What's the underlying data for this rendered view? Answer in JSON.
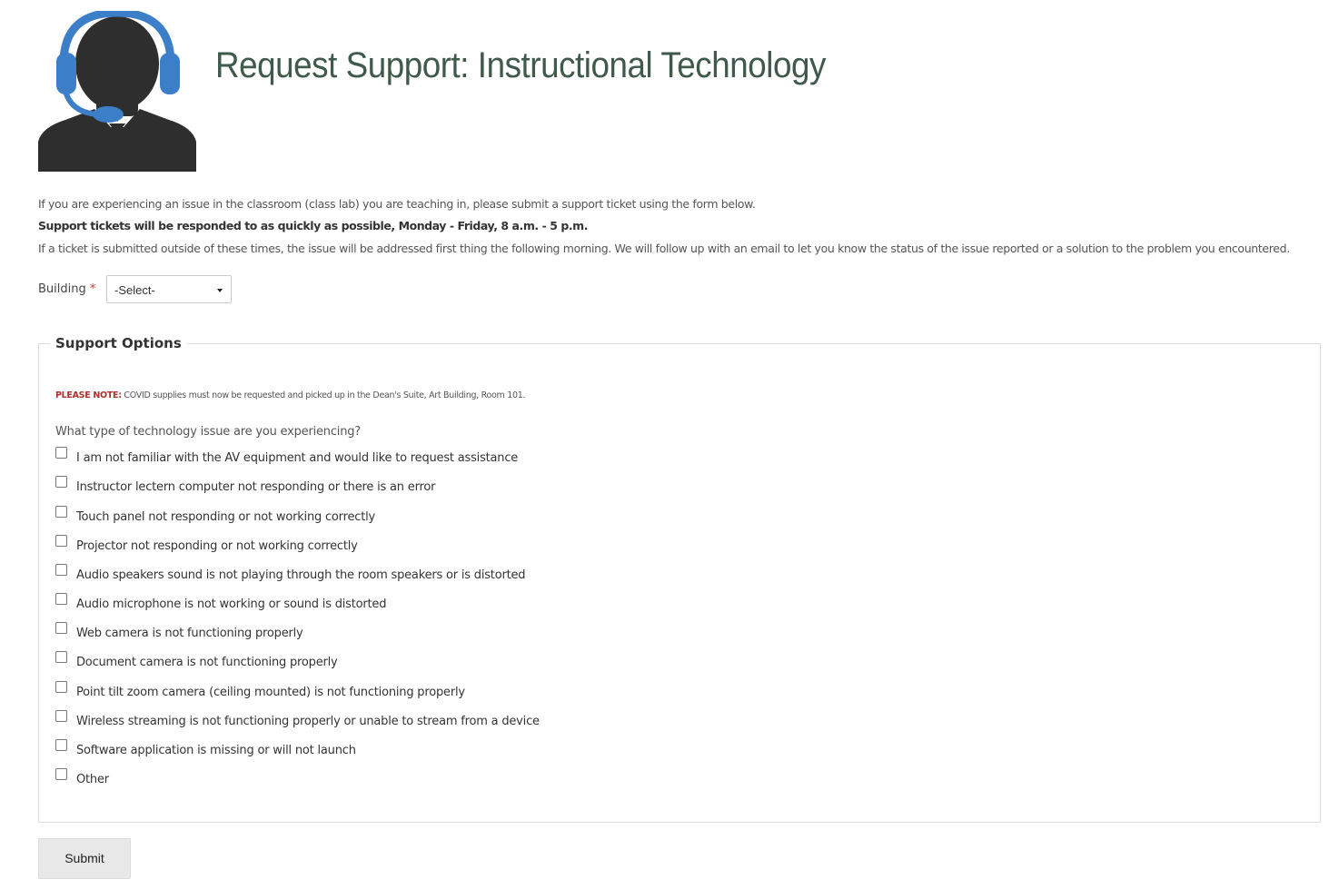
{
  "header": {
    "title": "Request Support: Instructional Technology",
    "logo_icon": "support-agent-headset-icon",
    "colors": {
      "title": "#3f5a4a",
      "headset": "#3d7ec9",
      "figure": "#2e2e2e"
    }
  },
  "intro": {
    "line1": "If you are experiencing an issue in the classroom (class lab) you are teaching in, please submit a support ticket using the form below.",
    "line2": "Support tickets will be responded to as quickly as possible, Monday - Friday, 8 a.m. - 5 p.m.",
    "line3": "If a ticket is submitted outside of these times, the issue will be addressed first thing the following morning. We will follow up with an email to let you know the status of the issue reported or a solution to the problem you encountered."
  },
  "building": {
    "label": "Building",
    "required_mark": "*",
    "selected": "-Select-"
  },
  "support_options": {
    "legend": "Support Options",
    "note_label": "PLEASE NOTE:",
    "note_text": " COVID supplies must now be requested and picked up in the Dean's Suite, Art Building, Room 101.",
    "question": "What type of technology issue are you experiencing?",
    "options": [
      {
        "label": "I am not familiar with the AV equipment and would like to request assistance",
        "checked": false
      },
      {
        "label": "Instructor lectern computer not responding or there is an error",
        "checked": false
      },
      {
        "label": "Touch panel not responding or not working correctly",
        "checked": false
      },
      {
        "label": "Projector not responding or not working correctly",
        "checked": false
      },
      {
        "label": "Audio speakers sound is not playing through the room speakers or is distorted",
        "checked": false
      },
      {
        "label": "Audio microphone is not working or sound is distorted",
        "checked": false
      },
      {
        "label": "Web camera is not functioning properly",
        "checked": false
      },
      {
        "label": "Document camera is not functioning properly",
        "checked": false
      },
      {
        "label": "Point tilt zoom camera (ceiling mounted) is not functioning properly",
        "checked": false
      },
      {
        "label": "Wireless streaming is not functioning properly or unable to stream from a device",
        "checked": false
      },
      {
        "label": "Software application is missing or will not launch",
        "checked": false
      },
      {
        "label": "Other",
        "checked": false
      }
    ]
  },
  "submit_label": "Submit"
}
